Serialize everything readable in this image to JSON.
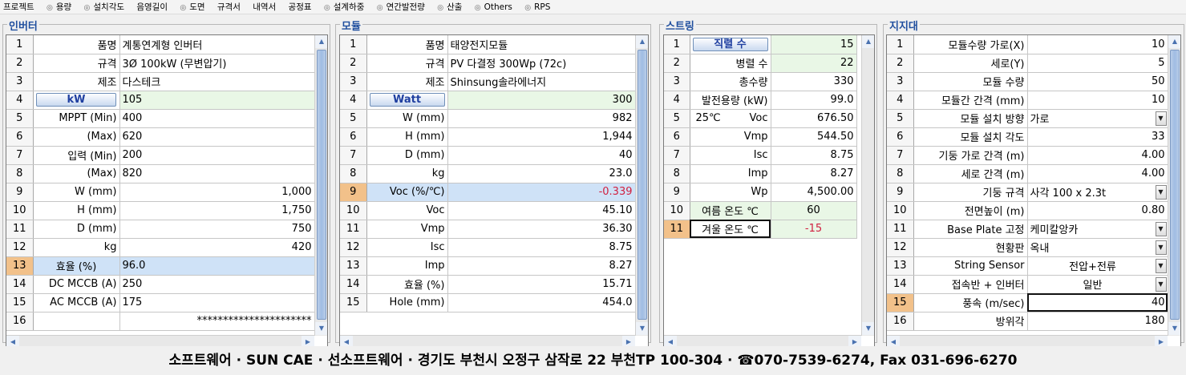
{
  "menu": [
    "프로젝트",
    "용량",
    "설치각도",
    "음영길이",
    "도면",
    "규격서",
    "내역서",
    "공정표",
    "설계하중",
    "연간발전량",
    "산출",
    "Others",
    "RPS"
  ],
  "footer": "소프트웨어 · SUN CAE · 선소프트웨어 · 경기도 부천시 오정구 삼작로 22 부천TP 100-304 · ☎070-7539-6274, Fax 031-696-6270",
  "inverter": {
    "title": "인버터",
    "rows": [
      {
        "n": "1",
        "label": "품명",
        "value": "계통연계형 인버터"
      },
      {
        "n": "2",
        "label": "규격",
        "value": "3Ø 100kW (무변압기)"
      },
      {
        "n": "3",
        "label": "제조",
        "value": "다스테크"
      },
      {
        "n": "4",
        "label": "kW",
        "value": "105"
      },
      {
        "n": "5",
        "label": "MPPT (Min)",
        "value": "400"
      },
      {
        "n": "6",
        "label": "(Max)",
        "value": "620"
      },
      {
        "n": "7",
        "label": "입력 (Min)",
        "value": "200"
      },
      {
        "n": "8",
        "label": "(Max)",
        "value": "820"
      },
      {
        "n": "9",
        "label": "W (mm)",
        "value": "1,000"
      },
      {
        "n": "10",
        "label": "H (mm)",
        "value": "1,750"
      },
      {
        "n": "11",
        "label": "D (mm)",
        "value": "750"
      },
      {
        "n": "12",
        "label": "kg",
        "value": "420"
      },
      {
        "n": "13",
        "label": "효율 (%)",
        "value": "96.0"
      },
      {
        "n": "14",
        "label": "DC MCCB (A)",
        "value": "250"
      },
      {
        "n": "15",
        "label": "AC MCCB (A)",
        "value": "175"
      },
      {
        "n": "16",
        "label": "",
        "value": "**********************"
      }
    ]
  },
  "module": {
    "title": "모듈",
    "rows": [
      {
        "n": "1",
        "label": "품명",
        "value": "태양전지모듈"
      },
      {
        "n": "2",
        "label": "규격",
        "value": "PV 다결정 300Wp (72c)"
      },
      {
        "n": "3",
        "label": "제조",
        "value": "Shinsung솔라에너지"
      },
      {
        "n": "4",
        "label": "Watt",
        "value": "300"
      },
      {
        "n": "5",
        "label": "W (mm)",
        "value": "982"
      },
      {
        "n": "6",
        "label": "H (mm)",
        "value": "1,944"
      },
      {
        "n": "7",
        "label": "D (mm)",
        "value": "40"
      },
      {
        "n": "8",
        "label": "kg",
        "value": "23.0"
      },
      {
        "n": "9",
        "label": "Voc (%/℃)",
        "value": "-0.339"
      },
      {
        "n": "10",
        "label": "Voc",
        "value": "45.10"
      },
      {
        "n": "11",
        "label": "Vmp",
        "value": "36.30"
      },
      {
        "n": "12",
        "label": "Isc",
        "value": "8.75"
      },
      {
        "n": "13",
        "label": "Imp",
        "value": "8.27"
      },
      {
        "n": "14",
        "label": "효율 (%)",
        "value": "15.71"
      },
      {
        "n": "15",
        "label": "Hole (mm)",
        "value": "454.0"
      }
    ]
  },
  "string": {
    "title": "스트링",
    "rows": [
      {
        "n": "1",
        "label": "직렬 수",
        "value": "15"
      },
      {
        "n": "2",
        "label": "병렬 수",
        "value": "22"
      },
      {
        "n": "3",
        "label": "총수량",
        "value": "330"
      },
      {
        "n": "4",
        "label": "발전용량 (kW)",
        "value": "99.0"
      },
      {
        "n": "5",
        "sub": "25℃",
        "label": "Voc",
        "value": "676.50"
      },
      {
        "n": "6",
        "label": "Vmp",
        "value": "544.50"
      },
      {
        "n": "7",
        "label": "Isc",
        "value": "8.75"
      },
      {
        "n": "8",
        "label": "Imp",
        "value": "8.27"
      },
      {
        "n": "9",
        "label": "Wp",
        "value": "4,500.00"
      },
      {
        "n": "10",
        "label": "여름 온도 ℃",
        "value": "60"
      },
      {
        "n": "11",
        "label": "겨울 온도 ℃",
        "value": "-15"
      }
    ]
  },
  "support": {
    "title": "지지대",
    "rows": [
      {
        "n": "1",
        "label": "모듈수량 가로(X)",
        "value": "10"
      },
      {
        "n": "2",
        "label": "세로(Y)",
        "value": "5"
      },
      {
        "n": "3",
        "label": "모듈 수량",
        "value": "50"
      },
      {
        "n": "4",
        "label": "모듈간 간격 (mm)",
        "value": "10"
      },
      {
        "n": "5",
        "label": "모듈 설치 방향",
        "value": "가로"
      },
      {
        "n": "6",
        "label": "모듈 설치 각도",
        "value": "33"
      },
      {
        "n": "7",
        "label": "기둥 가로 간격 (m)",
        "value": "4.00"
      },
      {
        "n": "8",
        "label": "세로 간격 (m)",
        "value": "4.00"
      },
      {
        "n": "9",
        "label": "기둥 규격",
        "value": "사각 100 x 2.3t"
      },
      {
        "n": "10",
        "label": "전면높이 (m)",
        "value": "0.80"
      },
      {
        "n": "11",
        "label": "Base Plate 고정",
        "value": "케미칼앙카"
      },
      {
        "n": "12",
        "label": "현황판",
        "value": "옥내"
      },
      {
        "n": "13",
        "label": "String Sensor",
        "value": "전압+전류"
      },
      {
        "n": "14",
        "label": "접속반 + 인버터",
        "value": "일반"
      },
      {
        "n": "15",
        "label": "풍속 (m/sec)",
        "value": "40"
      },
      {
        "n": "16",
        "label": "방위각",
        "value": "180"
      }
    ]
  }
}
